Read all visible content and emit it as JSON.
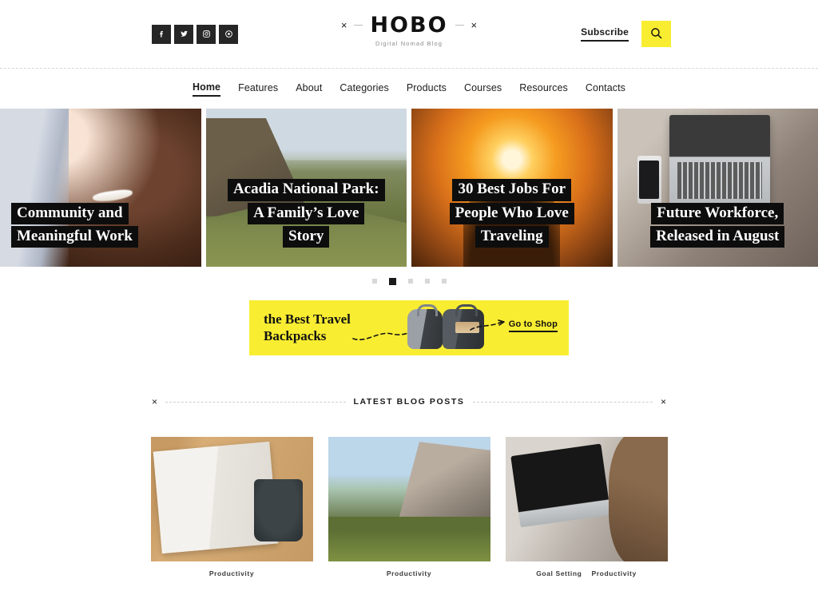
{
  "header": {
    "social": [
      {
        "name": "facebook-icon",
        "label": "Facebook"
      },
      {
        "name": "twitter-icon",
        "label": "Twitter"
      },
      {
        "name": "instagram-icon",
        "label": "Instagram"
      },
      {
        "name": "pinterest-icon",
        "label": "Pinterest"
      }
    ],
    "logo": {
      "text": "HOBO",
      "tagline": "Digital Nomad Blog",
      "ornament": "×"
    },
    "subscribe_label": "Subscribe",
    "search_icon": "search-icon",
    "accent_color": "#f9ed32"
  },
  "nav": {
    "items": [
      {
        "label": "Home",
        "active": true
      },
      {
        "label": "Features",
        "active": false
      },
      {
        "label": "About",
        "active": false
      },
      {
        "label": "Categories",
        "active": false
      },
      {
        "label": "Products",
        "active": false
      },
      {
        "label": "Courses",
        "active": false
      },
      {
        "label": "Resources",
        "active": false
      },
      {
        "label": "Contacts",
        "active": false
      }
    ]
  },
  "slider": {
    "slides": [
      {
        "lines": [
          "Community and",
          "Meaningful Work"
        ],
        "image": "smiling-woman-portrait"
      },
      {
        "lines": [
          "Acadia National Park:",
          "A Family’s Love",
          "Story"
        ],
        "image": "hiker-on-mountain-valley"
      },
      {
        "lines": [
          "30 Best Jobs For",
          "People Who Love",
          "Traveling"
        ],
        "image": "person-silhouette-at-sunset"
      },
      {
        "lines": [
          "Future Workforce,",
          "Released in August"
        ],
        "image": "laptop-on-desk-flatlay"
      }
    ],
    "dots": {
      "count": 5,
      "active_index": 1
    }
  },
  "banner": {
    "title_lines": [
      "the Best Travel",
      "Backpacks"
    ],
    "cta_label": "Go to Shop",
    "background": "#f9ed32",
    "product_images": [
      "grey-backpack",
      "dark-backpack"
    ]
  },
  "latest_section": {
    "title": "LATEST BLOG POSTS",
    "ornament": "×"
  },
  "posts": [
    {
      "image": "open-book-and-coffee-mug",
      "categories": [
        "Productivity"
      ]
    },
    {
      "image": "yosemite-valley-pine-trees",
      "categories": [
        "Productivity"
      ]
    },
    {
      "image": "woman-typing-on-laptop",
      "categories": [
        "Goal Setting",
        "Productivity"
      ]
    }
  ]
}
